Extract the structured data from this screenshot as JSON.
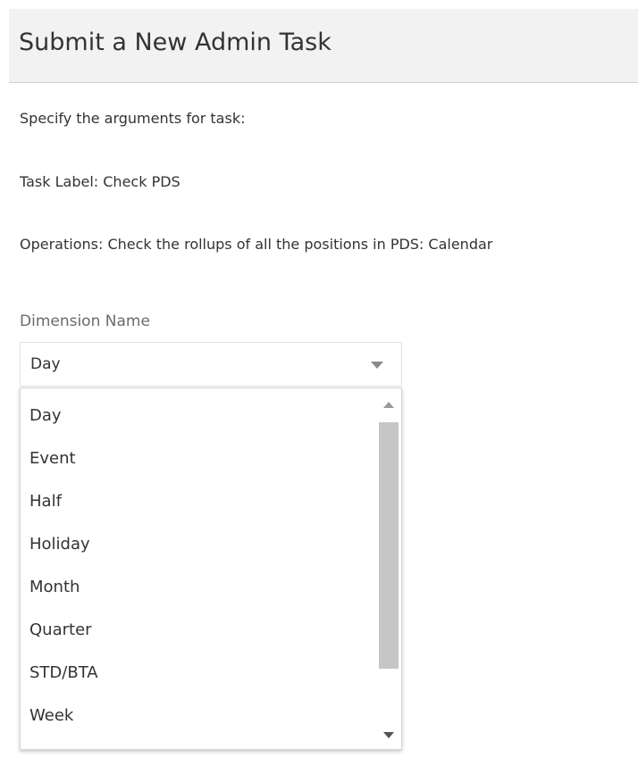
{
  "header": {
    "title": "Submit a New Admin Task"
  },
  "content": {
    "intro": "Specify the arguments for task:",
    "task_label": "Task Label: Check PDS",
    "operations": "Operations: Check the rollups of all the positions in PDS: Calendar"
  },
  "form": {
    "dimension_label": "Dimension Name",
    "selected_value": "Day",
    "options": [
      "Day",
      "Event",
      "Half",
      "Holiday",
      "Month",
      "Quarter",
      "STD/BTA",
      "Week"
    ]
  },
  "icons": {
    "select_caret": "chevron-down-icon",
    "scroll_up": "scroll-up-arrow-icon",
    "scroll_down": "scroll-down-arrow-icon"
  },
  "colors": {
    "header_background": "#f2f2f2",
    "scrollbar_thumb": "#c6c6c6",
    "muted_text": "#6b6b6b"
  }
}
